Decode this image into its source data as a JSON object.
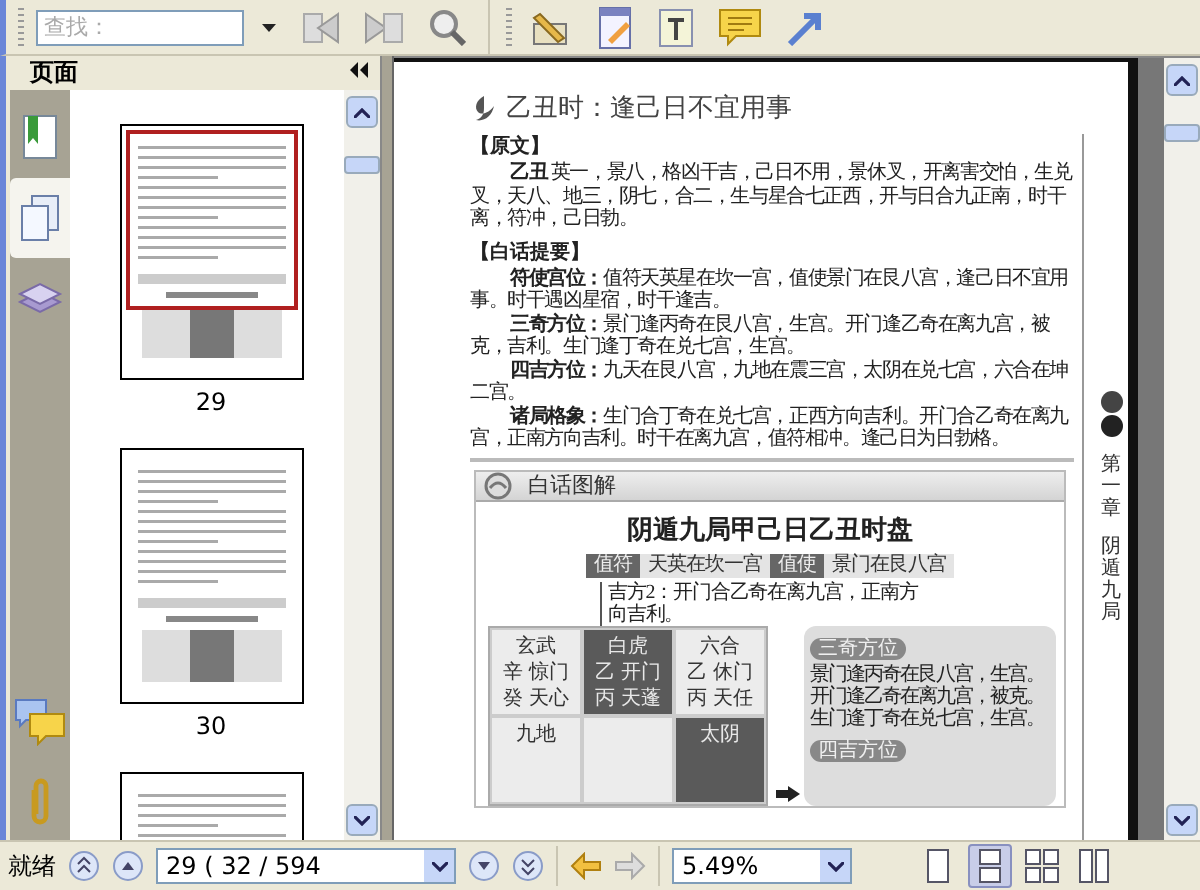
{
  "toolbar": {
    "search": {
      "placeholder": "查找："
    }
  },
  "panel": {
    "title": "页面",
    "nav": [
      {
        "kind": "bookmarks",
        "selected": false
      },
      {
        "kind": "pages",
        "selected": true
      },
      {
        "kind": "layers",
        "selected": false
      },
      {
        "kind": "comments",
        "selected": false
      },
      {
        "kind": "attachments",
        "selected": false
      }
    ],
    "thumbnails": [
      {
        "label": "29",
        "selected": true
      },
      {
        "label": "30",
        "selected": false
      },
      {
        "selected": false
      }
    ]
  },
  "document": {
    "heading": "乙丑时：逢己日不宜用事",
    "sections": [
      {
        "title": "【原文】",
        "paragraphs": [
          "**乙丑** 英一，景八，格凶干吉，己日不用，景休叉，开离害交怕，生兑叉，天八、地三，阴七，合二，生与星合七正西，开与日合九正南，时干离，符冲，己日勃。"
        ]
      },
      {
        "title": "【白话提要】",
        "paragraphs": [
          "**符使宫位：**值符天英星在坎一宫，值使景门在艮八宫，逢己日不宜用事。时干遇凶星宿，时干逢吉。",
          "**三奇方位：**景门逢丙奇在艮八宫，生宫。开门逢乙奇在离九宫，被克，吉利。生门逢丁奇在兑七宫，生宫。",
          "**四吉方位：**九天在艮八宫，九地在震三宫，太阴在兑七宫，六合在坤二宫。",
          "**诸局格象：**生门合丁奇在兑七宫，正西方向吉利。开门合乙奇在离九宫，正南方向吉利。时干在离九宫，值符相冲。逢己日为日勃格。"
        ]
      }
    ],
    "diagram": {
      "header": "白话图解",
      "title": "阴遁九局甲己日乙丑时盘",
      "chips": [
        {
          "kind": "label",
          "text": "值符"
        },
        {
          "kind": "value",
          "text": "天英在坎一宫"
        },
        {
          "kind": "label",
          "text": "值使"
        },
        {
          "kind": "value",
          "text": "景门在艮八宫"
        }
      ],
      "note": "吉方2：开门合乙奇在离九宫，正南方向吉利。",
      "cells": [
        {
          "name": "玄武",
          "dark": false,
          "lines": [
            "辛 惊门",
            "癸 天心"
          ]
        },
        {
          "name": "白虎",
          "dark": true,
          "lines": [
            "乙 开门",
            "丙 天蓬"
          ]
        },
        {
          "name": "六合",
          "dark": false,
          "lines": [
            "乙 休门",
            "丙 天任"
          ]
        },
        {
          "name": "九地",
          "dark": false
        },
        {
          "dark": false
        },
        {
          "name": "太阴",
          "dark": true
        }
      ],
      "panels": [
        {
          "title": "三奇方位",
          "lines": [
            "景门逢丙奇在艮八宫，生宫。",
            "开门逢乙奇在离九宫，被克。",
            "生门逢丁奇在兑七宫，生宫。"
          ]
        },
        {
          "title": "四吉方位"
        }
      ]
    },
    "side_tab": {
      "chapter": "第一章",
      "part": "阴遁九局"
    }
  },
  "status_bar": {
    "status": "就绪",
    "page_field": "29 ( 32 / 594",
    "zoom": "5.49%",
    "views": [
      {
        "kind": "single",
        "selected": false
      },
      {
        "kind": "continuous",
        "selected": true
      },
      {
        "kind": "facing",
        "selected": false
      },
      {
        "kind": "continuous-facing",
        "selected": false
      }
    ]
  }
}
